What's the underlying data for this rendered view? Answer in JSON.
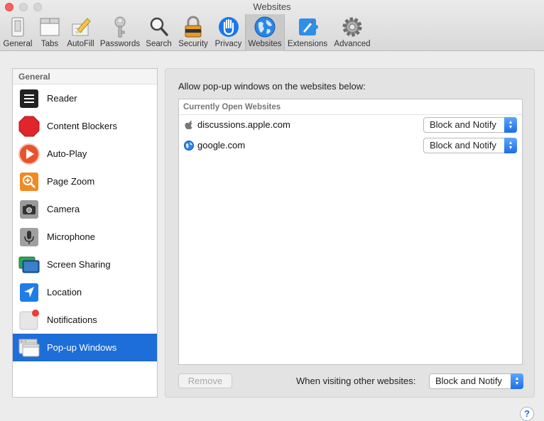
{
  "window": {
    "title": "Websites"
  },
  "toolbar": {
    "items": [
      {
        "label": "General",
        "icon": "general-switch-icon"
      },
      {
        "label": "Tabs",
        "icon": "tabs-icon"
      },
      {
        "label": "AutoFill",
        "icon": "autofill-pencil-icon"
      },
      {
        "label": "Passwords",
        "icon": "key-icon"
      },
      {
        "label": "Search",
        "icon": "magnifier-icon"
      },
      {
        "label": "Security",
        "icon": "padlock-icon"
      },
      {
        "label": "Privacy",
        "icon": "hand-icon"
      },
      {
        "label": "Websites",
        "icon": "globe-icon",
        "active": true
      },
      {
        "label": "Extensions",
        "icon": "extensions-icon"
      },
      {
        "label": "Advanced",
        "icon": "gear-icon"
      }
    ]
  },
  "sidebar": {
    "header": "General",
    "items": [
      {
        "label": "Reader",
        "icon": "reader-icon"
      },
      {
        "label": "Content Blockers",
        "icon": "stop-sign-icon"
      },
      {
        "label": "Auto-Play",
        "icon": "play-icon"
      },
      {
        "label": "Page Zoom",
        "icon": "zoom-icon"
      },
      {
        "label": "Camera",
        "icon": "camera-icon"
      },
      {
        "label": "Microphone",
        "icon": "microphone-icon"
      },
      {
        "label": "Screen Sharing",
        "icon": "screen-sharing-icon"
      },
      {
        "label": "Location",
        "icon": "location-arrow-icon"
      },
      {
        "label": "Notifications",
        "icon": "notifications-icon"
      },
      {
        "label": "Pop-up Windows",
        "icon": "popup-windows-icon",
        "selected": true
      }
    ]
  },
  "main": {
    "caption": "Allow pop-up windows on the websites below:",
    "table_header": "Currently Open Websites",
    "rows": [
      {
        "site": "discussions.apple.com",
        "icon": "apple-logo-icon",
        "setting": "Block and Notify"
      },
      {
        "site": "google.com",
        "icon": "globe-icon",
        "setting": "Block and Notify"
      }
    ],
    "remove_label": "Remove",
    "other_label": "When visiting other websites:",
    "other_setting": "Block and Notify",
    "help_label": "?"
  },
  "colors": {
    "accent": "#1d6ed8",
    "close": "#fc605c"
  }
}
